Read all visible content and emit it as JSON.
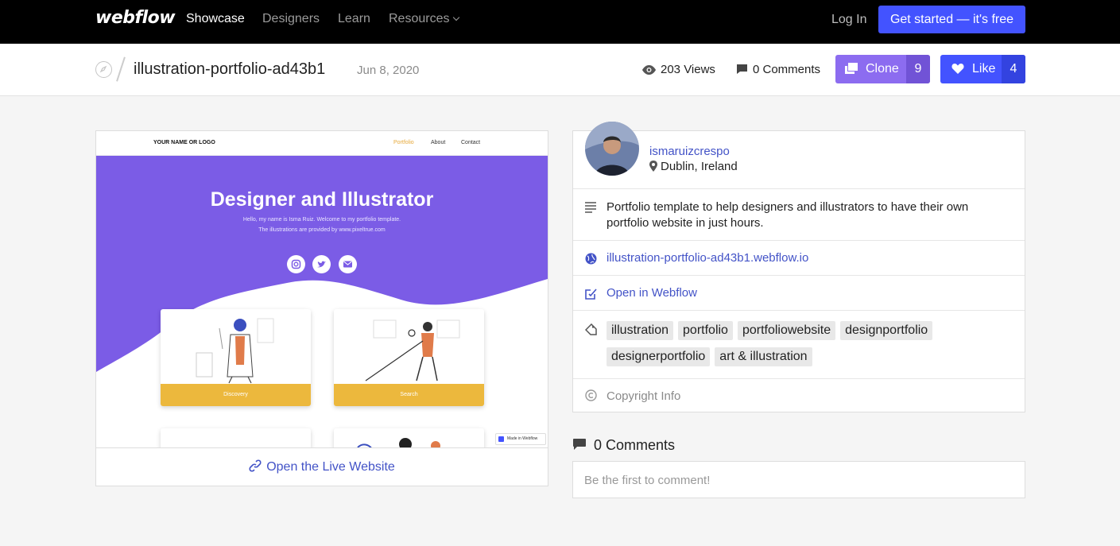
{
  "topnav": {
    "logo": "webflow",
    "links": [
      "Showcase",
      "Designers",
      "Learn",
      "Resources"
    ],
    "login": "Log In",
    "cta": "Get started — it's free"
  },
  "subheader": {
    "title": "illustration-portfolio-ad43b1",
    "date": "Jun 8, 2020",
    "views": "203 Views",
    "comments": "0 Comments",
    "clone_label": "Clone",
    "clone_count": "9",
    "like_label": "Like",
    "like_count": "4"
  },
  "preview": {
    "site_logo": "YOUR NAME OR LOGO",
    "site_nav": [
      "Portfolio",
      "About",
      "Contact"
    ],
    "hero_title": "Designer and Illustrator",
    "hero_sub": "Hello, my name is Isma Ruiz. Welcome to my portfolio template. The illustrations are provided by www.pixeltrue.com",
    "cards": [
      "Discovery",
      "Search"
    ],
    "badge": "Made in Webflow",
    "accent_purple": "#7b5ce6",
    "accent_yellow": "#ecb83d"
  },
  "open_live": "Open the Live Website",
  "info": {
    "author": "ismaruizcrespo",
    "location": "Dublin, Ireland",
    "description": "Portfolio template to help designers and illustrators to have their own portfolio website in just hours.",
    "site_url": "illustration-portfolio-ad43b1.webflow.io",
    "open_in_webflow": "Open in Webflow",
    "tags": [
      "illustration",
      "portfolio",
      "portfoliowebsite",
      "designportfolio",
      "designerportfolio",
      "art & illustration"
    ],
    "copyright": "Copyright Info"
  },
  "comments": {
    "heading": "0 Comments",
    "placeholder": "Be the first to comment!"
  }
}
